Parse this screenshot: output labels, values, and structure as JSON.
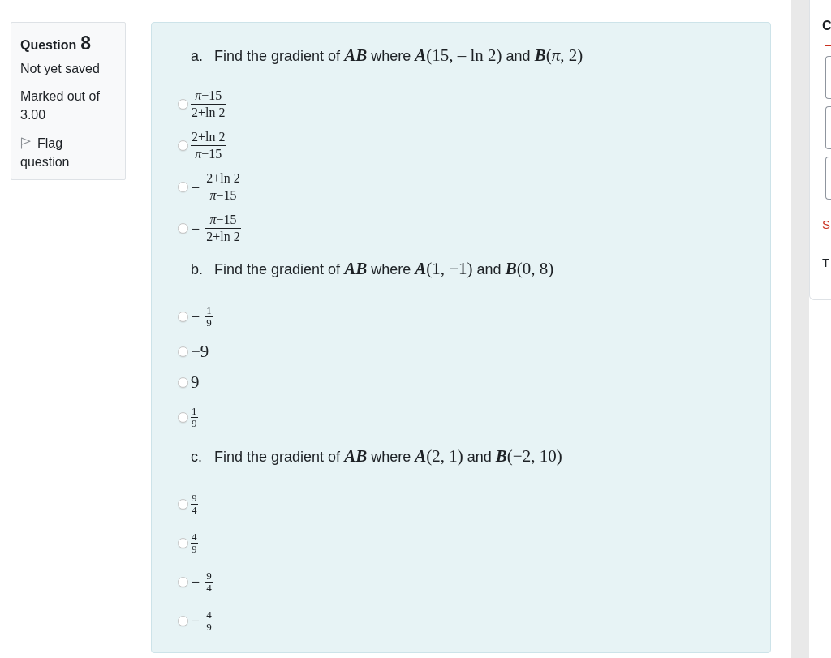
{
  "info": {
    "heading": "Question",
    "number": "8",
    "status": "Not yet saved",
    "marks": "Marked out of 3.00",
    "flag": {
      "label": "Flag question",
      "flagged": false
    }
  },
  "questions": [
    {
      "label": "a.",
      "prompt": [
        {
          "kind": "text",
          "text": "Find the gradient of"
        },
        {
          "kind": "math",
          "text": "**AB**"
        },
        {
          "kind": "text",
          "text": "where"
        },
        {
          "kind": "math",
          "text": "**A**(15, – ln 2)"
        },
        {
          "kind": "text",
          "text": "and"
        },
        {
          "kind": "math",
          "text": "**B**(*π*, 2)"
        }
      ],
      "options": [
        {
          "kind": "fraction",
          "numerator": "*π*−15",
          "denominator": "2+ln 2",
          "selected": false
        },
        {
          "kind": "fraction",
          "numerator": "2+ln 2",
          "denominator": "*π*−15",
          "selected": false
        },
        {
          "kind": "fraction",
          "sign": "−",
          "numerator": "2+ln 2",
          "denominator": "*π*−15",
          "selected": false
        },
        {
          "kind": "fraction",
          "sign": "−",
          "numerator": "*π*−15",
          "denominator": "2+ln 2",
          "selected": false
        }
      ]
    },
    {
      "label": "b.",
      "prompt": [
        {
          "kind": "text",
          "text": "Find the gradient of"
        },
        {
          "kind": "math",
          "text": "**AB**"
        },
        {
          "kind": "text",
          "text": "where"
        },
        {
          "kind": "math",
          "text": "**A**(1, −1)"
        },
        {
          "kind": "text",
          "text": "and"
        },
        {
          "kind": "math",
          "text": "**B**(0, 8)"
        }
      ],
      "options": [
        {
          "kind": "small-fraction",
          "sign": "−",
          "numerator": "1",
          "denominator": "9",
          "selected": false
        },
        {
          "kind": "number",
          "text": "−9",
          "selected": false
        },
        {
          "kind": "number",
          "text": "9",
          "selected": false
        },
        {
          "kind": "small-fraction",
          "numerator": "1",
          "denominator": "9",
          "selected": false
        }
      ]
    },
    {
      "label": "c.",
      "prompt": [
        {
          "kind": "text",
          "text": "Find the gradient of"
        },
        {
          "kind": "math",
          "text": "**AB**"
        },
        {
          "kind": "text",
          "text": "where"
        },
        {
          "kind": "math",
          "text": "**A**(2, 1)"
        },
        {
          "kind": "text",
          "text": "and"
        },
        {
          "kind": "math",
          "text": "**B**(−2, 10)"
        }
      ],
      "options": [
        {
          "kind": "small-fraction",
          "numerator": "9",
          "denominator": "4",
          "selected": false
        },
        {
          "kind": "small-fraction",
          "numerator": "4",
          "denominator": "9",
          "selected": false
        },
        {
          "kind": "small-fraction",
          "sign": "−",
          "numerator": "9",
          "denominator": "4",
          "selected": false
        },
        {
          "kind": "small-fraction",
          "sign": "−",
          "numerator": "4",
          "denominator": "9",
          "selected": false
        }
      ]
    }
  ],
  "navigation": {
    "heading": "C",
    "link": "S",
    "text": "T"
  }
}
